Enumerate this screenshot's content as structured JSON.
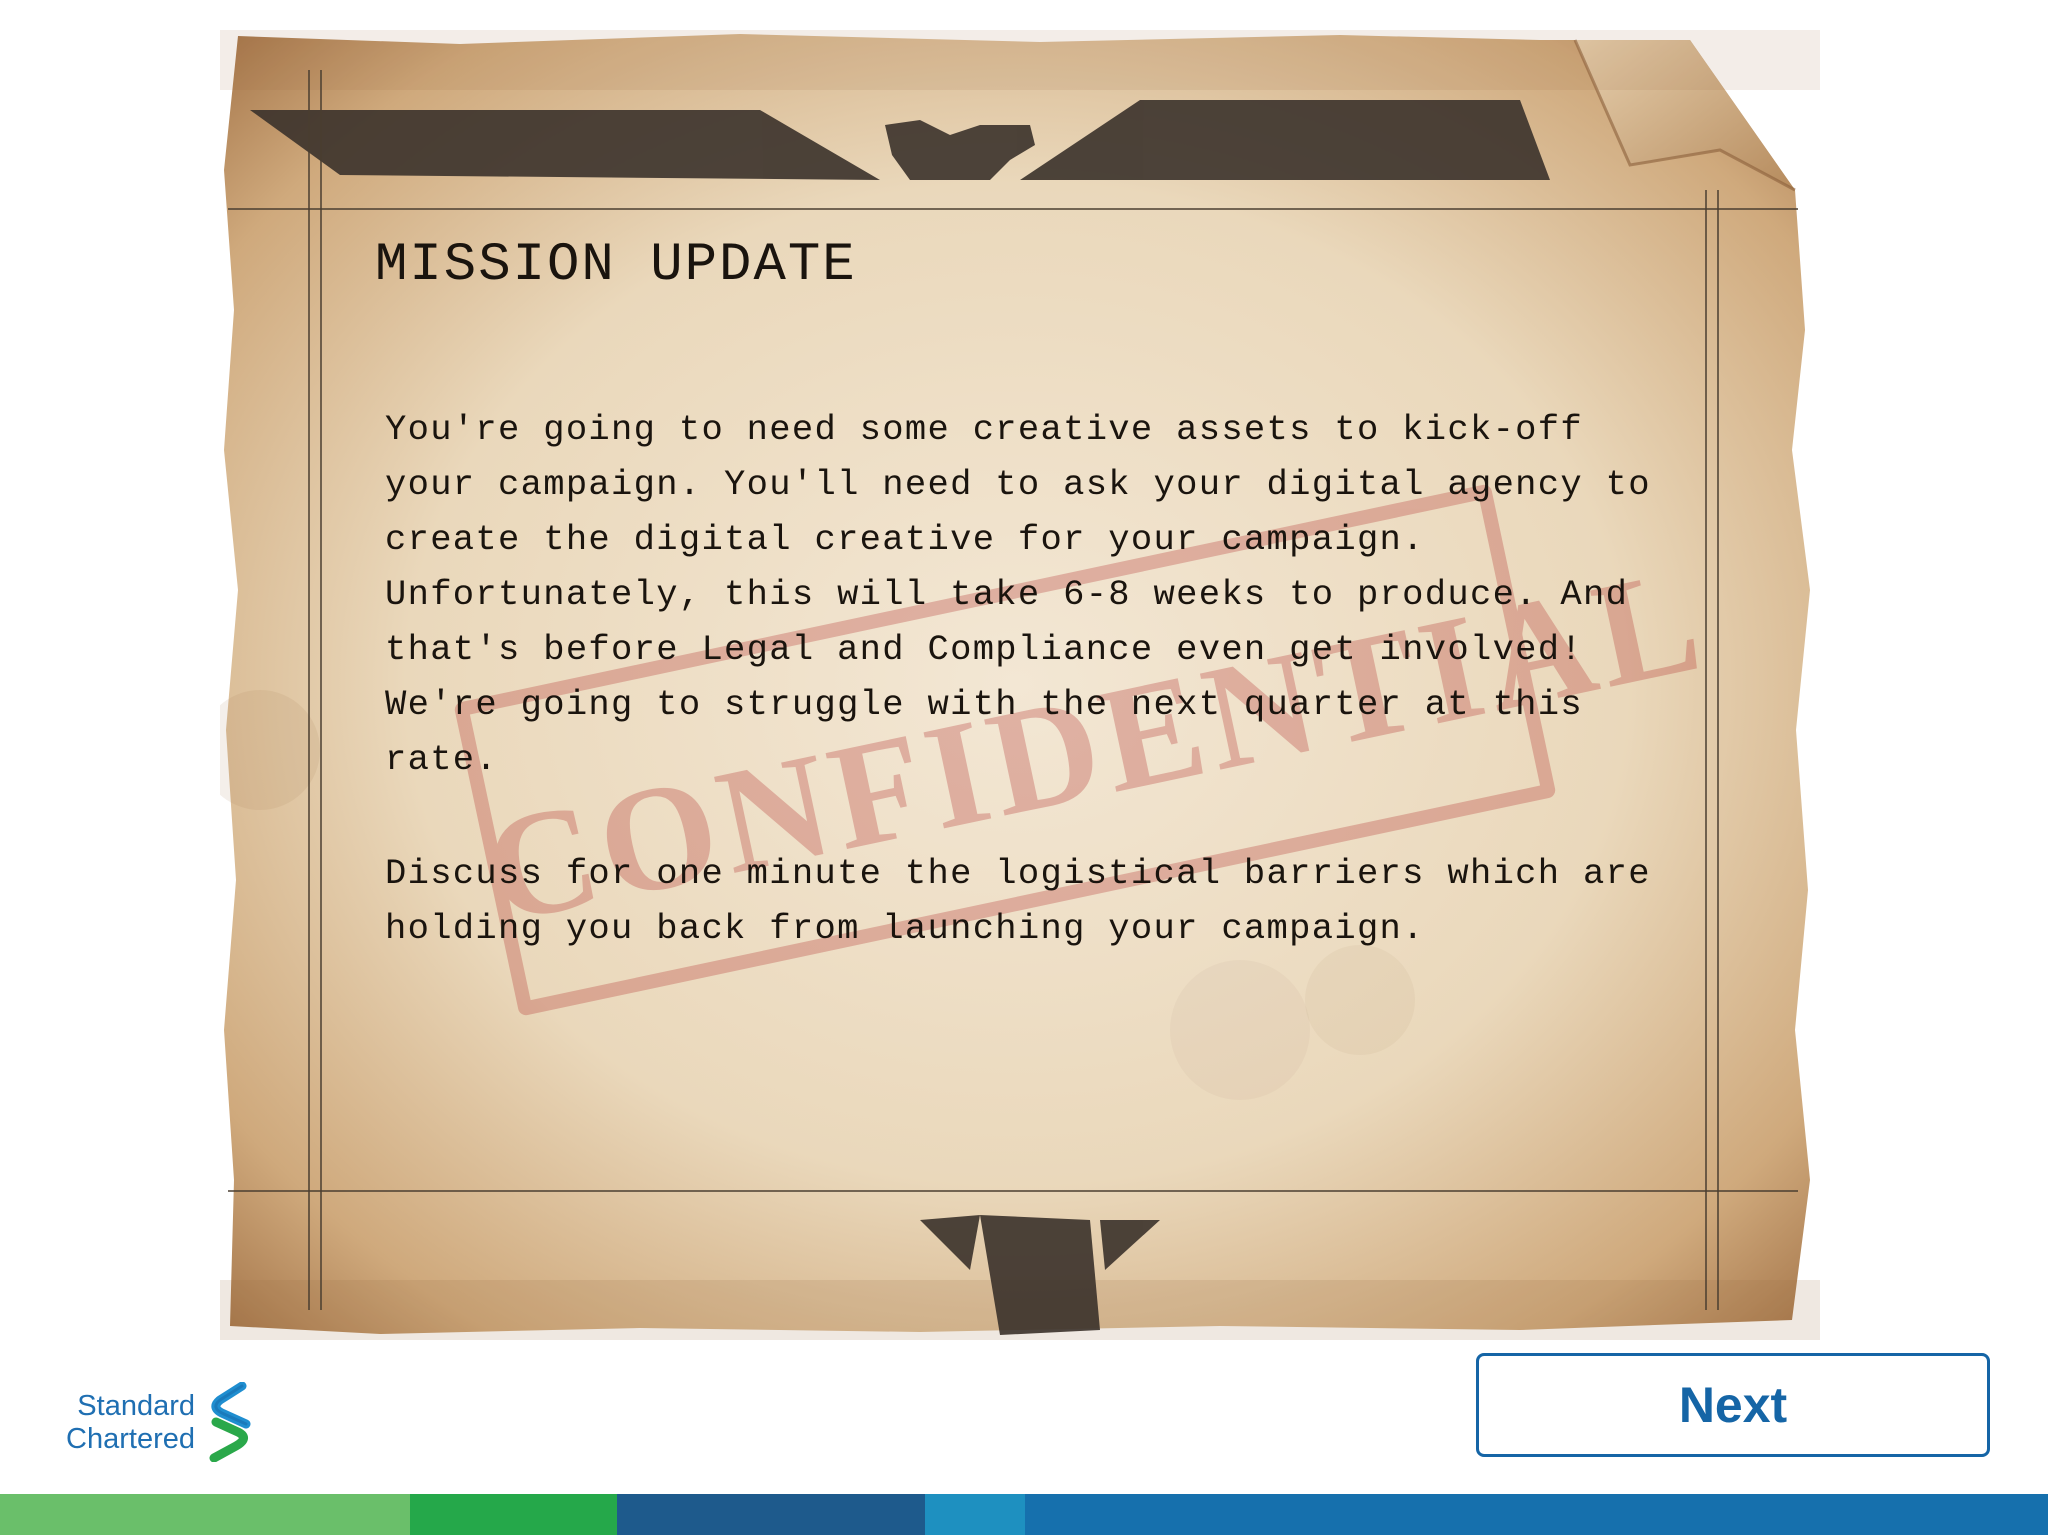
{
  "mission": {
    "title": "MISSION UPDATE",
    "paragraph_1": "You're going to need some creative assets to kick-off your campaign. You'll need to ask your digital agency to create the digital creative for your campaign. Unfortunately, this will take 6-8 weeks to produce. And that's before Legal and Compliance even get involved! We're going to struggle with the next quarter at this rate.",
    "paragraph_2": "Discuss for one minute the logistical barriers which are holding you back from launching your campaign.",
    "stamp_text": "CONFIDENTIAL"
  },
  "brand": {
    "line_1": "Standard",
    "line_2": "Chartered",
    "logo_icon": "standard-chartered-logo-icon",
    "colors": {
      "blue": "#1f6fb2",
      "green": "#2aa84a"
    }
  },
  "navigation": {
    "next_label": "Next"
  },
  "footer_strip": {
    "colors": [
      "#6abf6a",
      "#25a84a",
      "#1e5a8c",
      "#1e90c0",
      "#1670ad"
    ]
  },
  "icons": {
    "top_ornament": "winged-emblem-icon",
    "bottom_ornament": "tie-emblem-icon"
  }
}
